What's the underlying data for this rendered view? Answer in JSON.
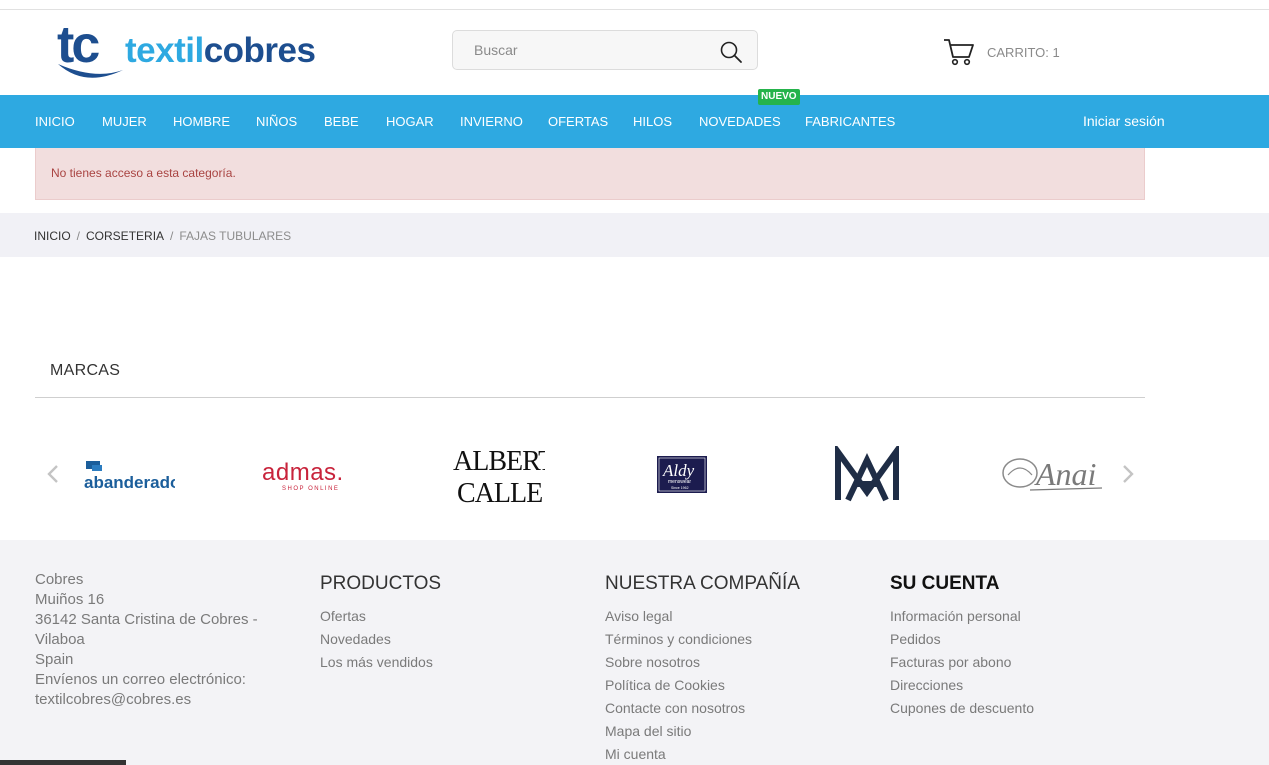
{
  "header": {
    "logo_mark": "tc",
    "logo_text_light": "textil",
    "logo_text_bold": "cobres",
    "search_placeholder": "Buscar",
    "cart_label": "CARRITO: 1"
  },
  "nav": {
    "items": [
      "INICIO",
      "MUJER",
      "HOMBRE",
      "NIÑOS",
      "BEBE",
      "HOGAR",
      "INVIERNO",
      "OFERTAS",
      "HILOS",
      "NOVEDADES",
      "FABRICANTES"
    ],
    "badge": "NUEVO",
    "login": "Iniciar sesión"
  },
  "alert": {
    "message": "No tienes acceso a esta categoría."
  },
  "breadcrumb": {
    "items": [
      "INICIO",
      "CORSETERIA",
      "FAJAS TUBULARES"
    ],
    "separator": "/"
  },
  "brands": {
    "title": "MARCAS",
    "logos": {
      "abanderado": "abanderado",
      "admas": "admas.",
      "admas_sub": "SHOP ONLINE",
      "albert_line1": "ALBERT",
      "albert_line2": "CALLE",
      "aldy": "Aldy",
      "aldy_sub": "menswear",
      "aldy_since": "Since 1962",
      "anai": "Anai"
    }
  },
  "footer": {
    "address": [
      "Cobres",
      "Muiños 16",
      "36142 Santa Cristina de Cobres -",
      "Vilaboa",
      "Spain",
      "Envíenos un correo electrónico:",
      "textilcobres@cobres.es"
    ],
    "products": {
      "title": "PRODUCTOS",
      "links": [
        "Ofertas",
        "Novedades",
        "Los más vendidos"
      ]
    },
    "company": {
      "title": "NUESTRA COMPAÑÍA",
      "links": [
        "Aviso legal",
        "Términos y condiciones",
        "Sobre nosotros",
        "Política de Cookies",
        "Contacte con nosotros",
        "Mapa del sitio",
        "Mi cuenta"
      ]
    },
    "account": {
      "title": "SU CUENTA",
      "links": [
        "Información personal",
        "Pedidos",
        "Facturas por abono",
        "Direcciones",
        "Cupones de descuento"
      ]
    }
  },
  "colors": {
    "nav_bg": "#2ea9e1",
    "logo_dark": "#1d4e8f",
    "logo_light": "#2ea9e1",
    "badge": "#25b34b",
    "alert_bg": "#f2dede",
    "alert_text": "#a94442",
    "footer_bg": "#f3f3f6"
  }
}
